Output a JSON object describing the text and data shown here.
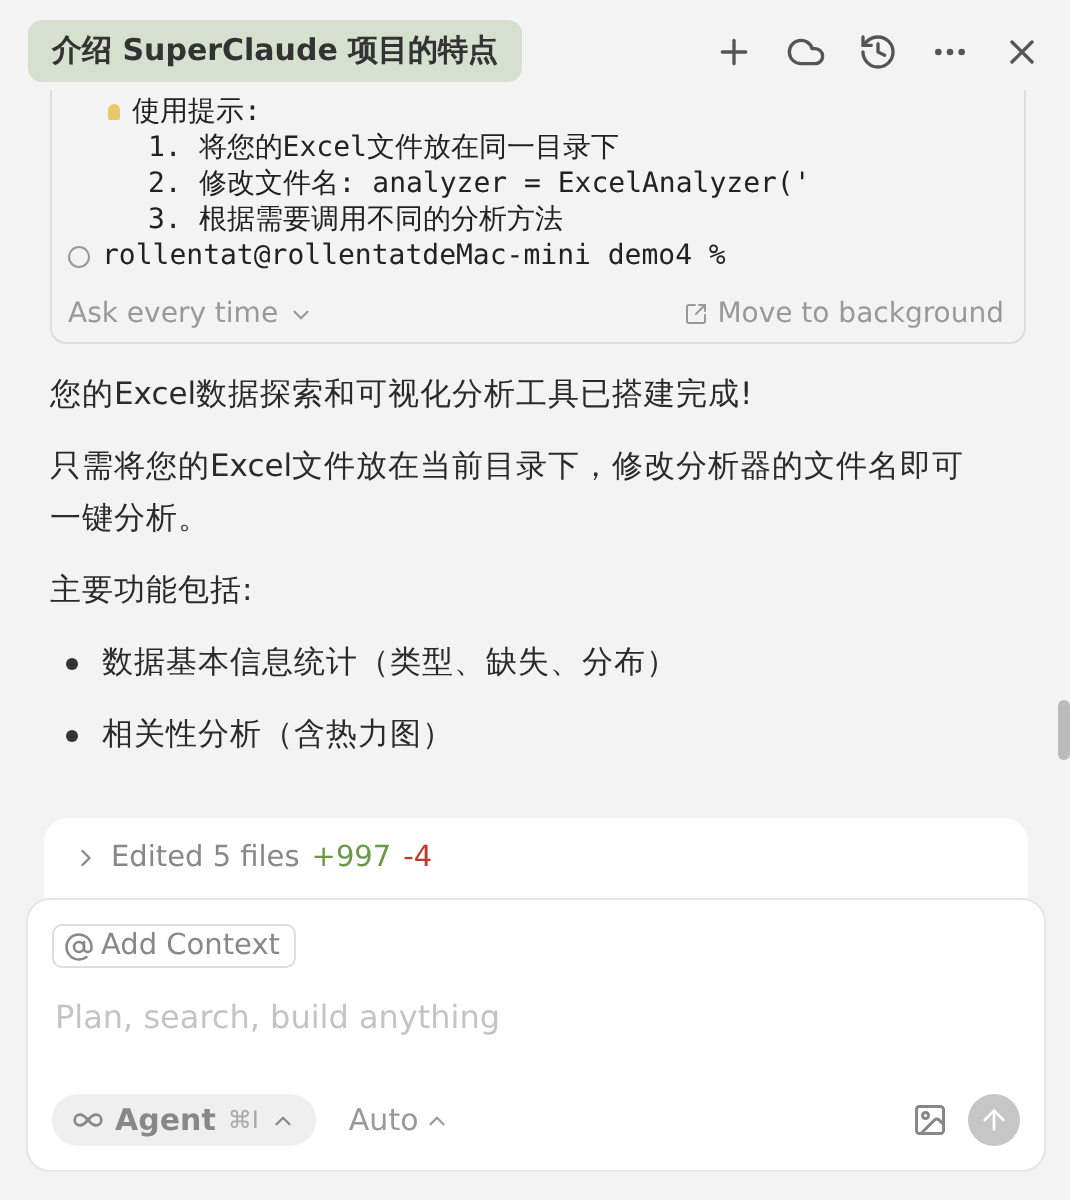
{
  "header": {
    "title": "介绍 SuperClaude 项目的特点"
  },
  "terminal": {
    "lines": [
      {
        "kind": "tip",
        "text": "使用提示:"
      },
      {
        "kind": "step",
        "text": "1. 将您的Excel文件放在同一目录下"
      },
      {
        "kind": "step",
        "text": "2. 修改文件名: analyzer = ExcelAnalyzer('"
      },
      {
        "kind": "step",
        "text": "3. 根据需要调用不同的分析方法"
      },
      {
        "kind": "prompt",
        "text": "rollentat@rollentatdeMac-mini demo4 %"
      }
    ],
    "run_mode": "Ask every time",
    "background_button": "Move to background"
  },
  "message": {
    "paragraphs": [
      "您的Excel数据探索和可视化分析工具已搭建完成!",
      "只需将您的Excel文件放在当前目录下，修改分析器的文件名即可一键分析。",
      "主要功能包括:"
    ],
    "bullets": [
      "数据基本信息统计（类型、缺失、分布）",
      "相关性分析（含热力图）"
    ]
  },
  "edits": {
    "expanded": false,
    "label": "Edited 5 files",
    "added": "+997",
    "removed": "-4"
  },
  "composer": {
    "context_button": "Add Context",
    "placeholder": "Plan, search, build anything",
    "mode": "Agent",
    "shortcut": "⌘I",
    "model": "Auto"
  }
}
